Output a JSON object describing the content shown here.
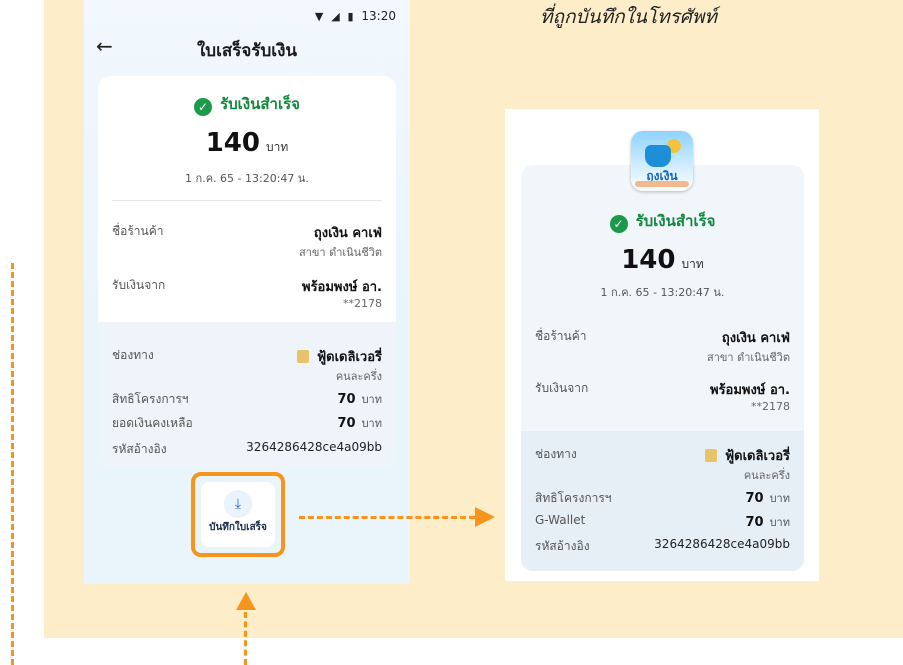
{
  "heading": "ที่ถูกบันทึกในโทรศัพท์",
  "status_bar": {
    "time": "13:20"
  },
  "screen": {
    "title": "ใบเสร็จรับเงิน"
  },
  "receipt": {
    "status": "รับเงินสำเร็จ",
    "amount": "140",
    "currency": "บาท",
    "datetime": "1 ก.ค. 65 - 13:20:47 น.",
    "shop_label": "ชื่อร้านค้า",
    "shop_name": "ถุงเงิน คาเฟ่",
    "shop_branch": "สาขา ดำเนินชีวิต",
    "from_label": "รับเงินจาก",
    "from_name": "พร้อมพงษ์ อา.",
    "from_account": "**2178",
    "channel_label": "ช่องทาง",
    "channel_name": "ฟู้ดเดลิเวอรี่",
    "channel_sub": "คนละครึ่ง",
    "rights_label": "สิทธิโครงการฯ",
    "rights_value": "70",
    "balance_label": "ยอดเงินคงเหลือ",
    "balance_value": "70",
    "ref_label": "รหัสอ้างอิง",
    "ref_value": "3264286428ce4a09bb"
  },
  "save_button": {
    "label": "บันทึกใบเสร็จ"
  },
  "saved_receipt": {
    "logo_text": "ถุงเงิน",
    "wallet_label": "G-Wallet",
    "wallet_value": "70"
  },
  "colors": {
    "accent": "#f7941d",
    "success": "#1b9a4b",
    "panel": "#fdeec9"
  }
}
